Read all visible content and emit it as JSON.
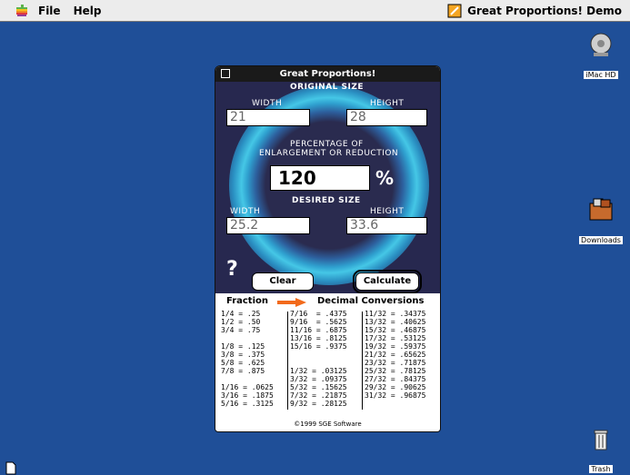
{
  "menubar": {
    "apple_icon": "apple-logo-icon",
    "items": [
      "File",
      "Help"
    ],
    "app_name": "Great Proportions! Demo"
  },
  "desktop": {
    "icons": [
      {
        "name": "iMac HD",
        "icon": "hard-disk-icon"
      },
      {
        "name": "Downloads",
        "icon": "folder-icon"
      },
      {
        "name": "Trash",
        "icon": "trash-icon"
      }
    ]
  },
  "window": {
    "title": "Great Proportions!",
    "original_size_label": "ORIGINAL SIZE",
    "width_label": "WIDTH",
    "height_label": "HEIGHT",
    "original_width": "21",
    "original_height": "28",
    "percentage_label_line1": "PERCENTAGE OF",
    "percentage_label_line2": "ENLARGEMENT OR REDUCTION",
    "percentage_value": "120",
    "percent_sign": "%",
    "desired_size_label": "DESIRED SIZE",
    "desired_width": "25.2",
    "desired_height": "33.6",
    "help_label": "?",
    "clear_button": "Clear",
    "calculate_button": "Calculate"
  },
  "table": {
    "heading_left": "Fraction",
    "heading_right": "Decimal Conversions",
    "col1": "1/4 = .25\n1/2 = .50\n3/4 = .75\n\n1/8 = .125\n3/8 = .375\n5/8 = .625\n7/8 = .875\n\n1/16 = .0625\n3/16 = .1875\n5/16 = .3125",
    "col2": "7/16  = .4375\n9/16  = .5625\n11/16 = .6875\n13/16 = .8125\n15/16 = .9375\n\n\n1/32 = .03125\n3/32 = .09375\n5/32 = .15625\n7/32 = .21875\n9/32 = .28125",
    "col3": "11/32 = .34375\n13/32 = .40625\n15/32 = .46875\n17/32 = .53125\n19/32 = .59375\n21/32 = .65625\n23/32 = .71875\n25/32 = .78125\n27/32 = .84375\n29/32 = .90625\n31/32 = .96875",
    "footer": "©1999 SGE Software"
  }
}
